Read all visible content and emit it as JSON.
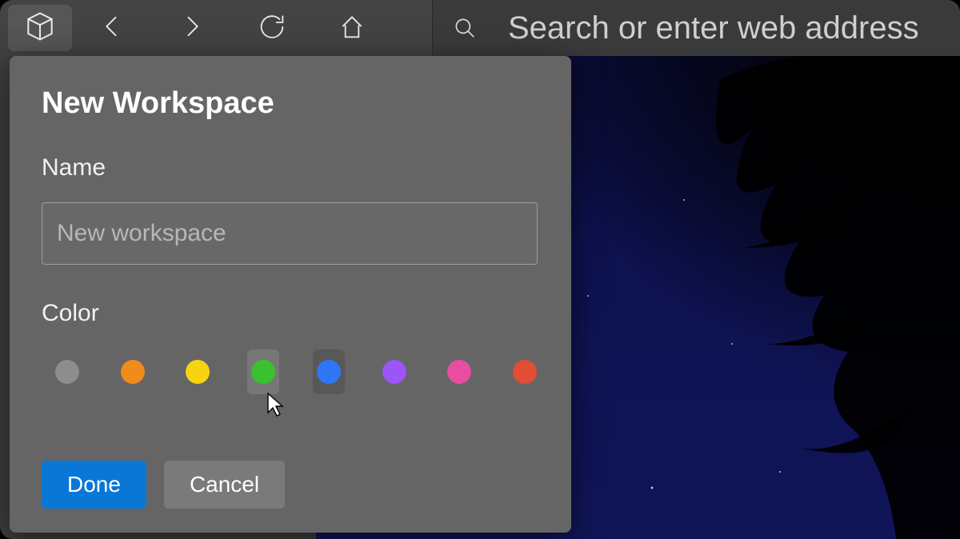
{
  "toolbar": {
    "address_placeholder": "Search or enter web address",
    "address_value": ""
  },
  "popup": {
    "title": "New Workspace",
    "name_label": "Name",
    "name_placeholder": "New workspace",
    "name_value": "",
    "color_label": "Color",
    "colors": [
      {
        "name": "gray",
        "hex": "#8d8d8d"
      },
      {
        "name": "orange",
        "hex": "#f08b1d"
      },
      {
        "name": "yellow",
        "hex": "#f7d412"
      },
      {
        "name": "green",
        "hex": "#38c22e"
      },
      {
        "name": "blue",
        "hex": "#2f76f6"
      },
      {
        "name": "purple",
        "hex": "#9c55f7"
      },
      {
        "name": "pink",
        "hex": "#e74ea0"
      },
      {
        "name": "red",
        "hex": "#e14e33"
      }
    ],
    "hover_index": 3,
    "done_label": "Done",
    "cancel_label": "Cancel"
  }
}
